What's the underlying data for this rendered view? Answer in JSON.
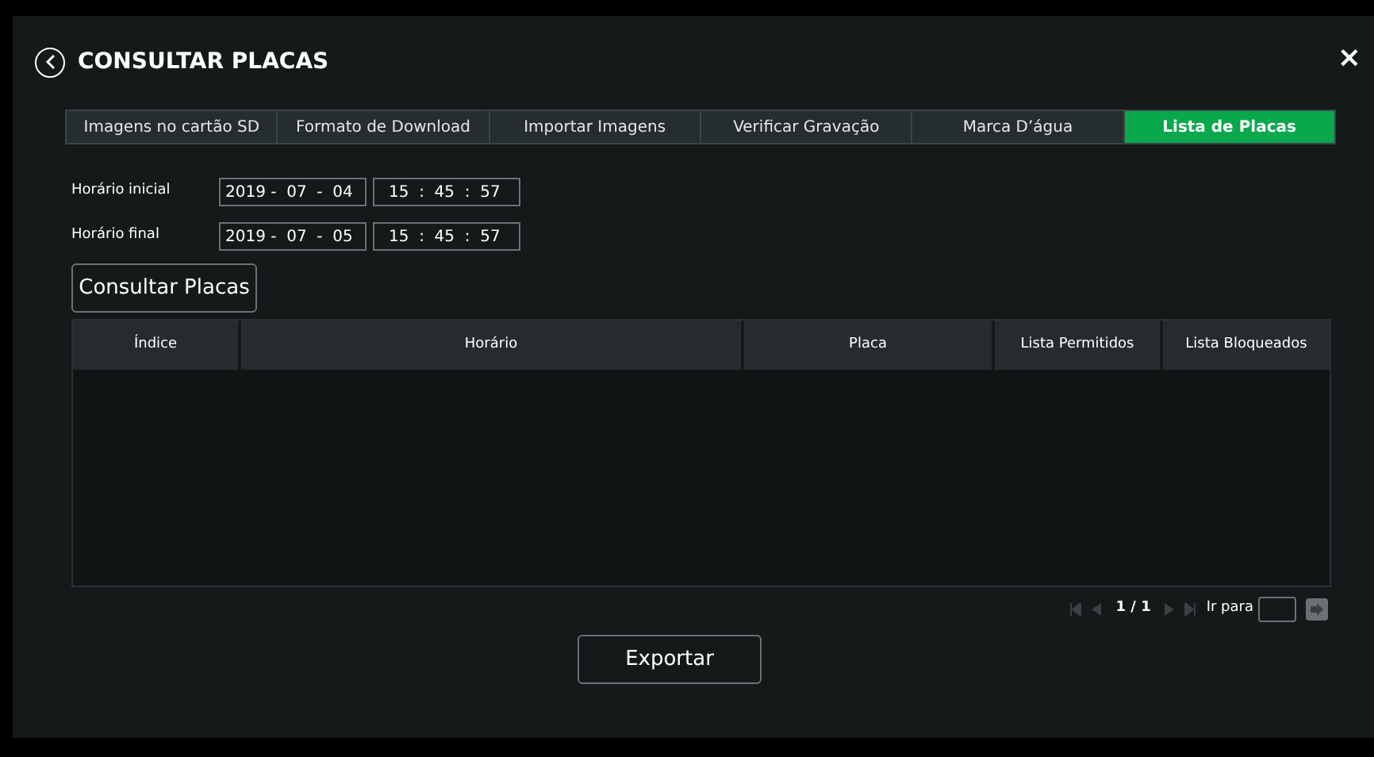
{
  "window": {
    "title": "CONSULTAR PLACAS",
    "close": "×"
  },
  "tabs": [
    {
      "label": "Imagens no cartão SD",
      "selected": false
    },
    {
      "label": "Formato de Download",
      "selected": false
    },
    {
      "label": "Importar Imagens",
      "selected": false
    },
    {
      "label": "Verificar Gravação",
      "selected": false
    },
    {
      "label": "Marca D’água",
      "selected": false
    },
    {
      "label": "Lista de Placas",
      "selected": true
    }
  ],
  "time_fields": [
    {
      "label": "Horário inicial",
      "date": "2019 -  07  -  04",
      "time": "15  :  45  :  57"
    },
    {
      "label": "Horário final",
      "date": "2019 -  07  -  05",
      "time": "15  :  45  :  57"
    }
  ],
  "query_button": "Consultar Placas",
  "table": {
    "columns": [
      "Índice",
      "Horário",
      "Placa",
      "Lista Permitidos",
      "Lista Bloqueados"
    ]
  },
  "pagination": {
    "page": "1 / 1",
    "goto_label": "Ir para"
  },
  "export_button": "Exportar"
}
